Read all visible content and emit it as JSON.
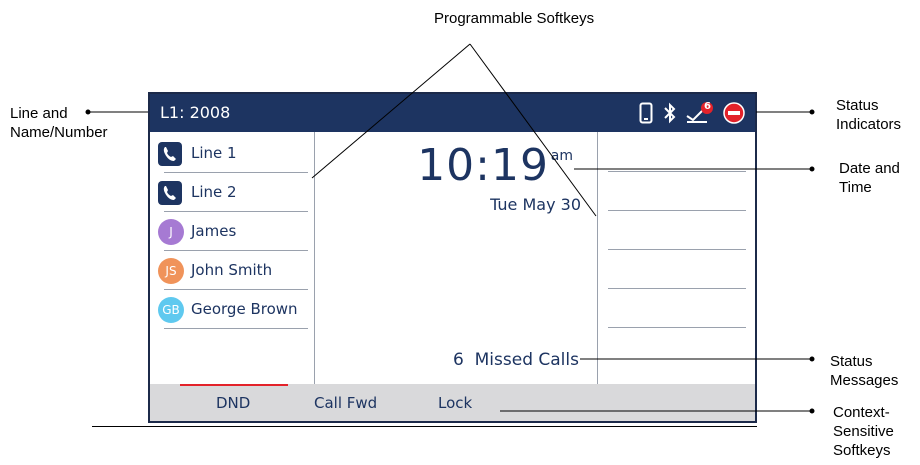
{
  "callouts": {
    "programmable": "Programmable Softkeys",
    "line_name": [
      "Line and",
      "Name/Number"
    ],
    "status_indicators": [
      "Status",
      "Indicators"
    ],
    "date_time": [
      "Date and",
      "Time"
    ],
    "status_messages": [
      "Status",
      "Messages"
    ],
    "context_sensitive": [
      "Context-",
      "Sensitive",
      "Softkeys"
    ]
  },
  "screen": {
    "line_label": "L1: 2008",
    "status_icons": [
      "mobile-icon",
      "bluetooth-icon",
      "voicemail-icon",
      "dnd-icon"
    ],
    "voicemail_count": "6",
    "time": "10:19",
    "ampm": "am",
    "date": "Tue May 30",
    "missed_calls": "6  Missed Calls",
    "keys": [
      {
        "label": "Line 1",
        "type": "line"
      },
      {
        "label": "Line 2",
        "type": "line"
      },
      {
        "label": "James",
        "type": "contact",
        "initials": "J",
        "color": "#a67ad3"
      },
      {
        "label": "John Smith",
        "type": "contact",
        "initials": "JS",
        "color": "#f0935a"
      },
      {
        "label": "George Brown",
        "type": "contact",
        "initials": "GB",
        "color": "#5fc9ef"
      }
    ],
    "softkeys": [
      "DND",
      "Call Fwd",
      "Lock"
    ]
  },
  "colors": {
    "bar": "#1d3461",
    "text_blue": "#1d3461",
    "softkey_bar": "#d9d9db",
    "active_indicator": "#e3222a",
    "dnd": "#e3222a"
  }
}
